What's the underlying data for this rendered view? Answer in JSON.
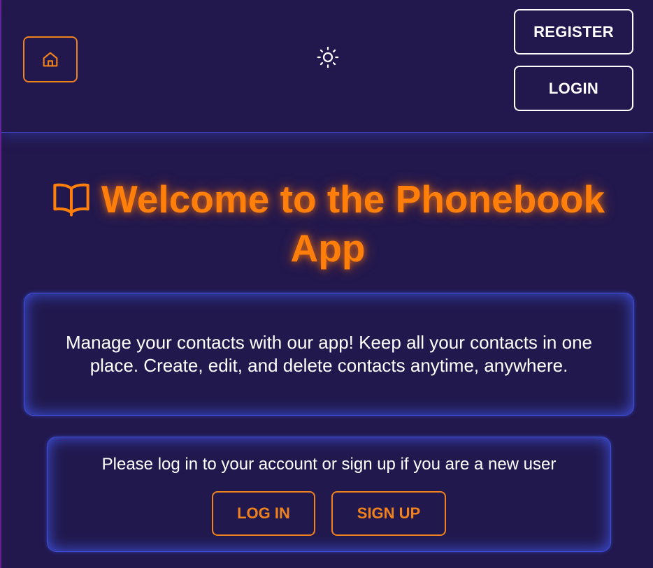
{
  "header": {
    "home_icon": "home-icon",
    "theme_icon": "sun-icon",
    "register_label": "REGISTER",
    "login_label": "LOGIN"
  },
  "main": {
    "title_icon": "open-book-icon",
    "title": "Welcome to the Phonebook App",
    "description": "Manage your contacts with our app! Keep all your contacts in one place. Create, edit, and delete contacts anytime, anywhere.",
    "auth_prompt": "Please log in to your account or sign up if you are a new user",
    "login_action_label": "LOG IN",
    "signup_action_label": "SIGN UP"
  },
  "colors": {
    "background": "#22184d",
    "accent": "#f0821e",
    "title": "#ff7f0a",
    "card_glow": "#465fff",
    "text": "#ffffff"
  }
}
